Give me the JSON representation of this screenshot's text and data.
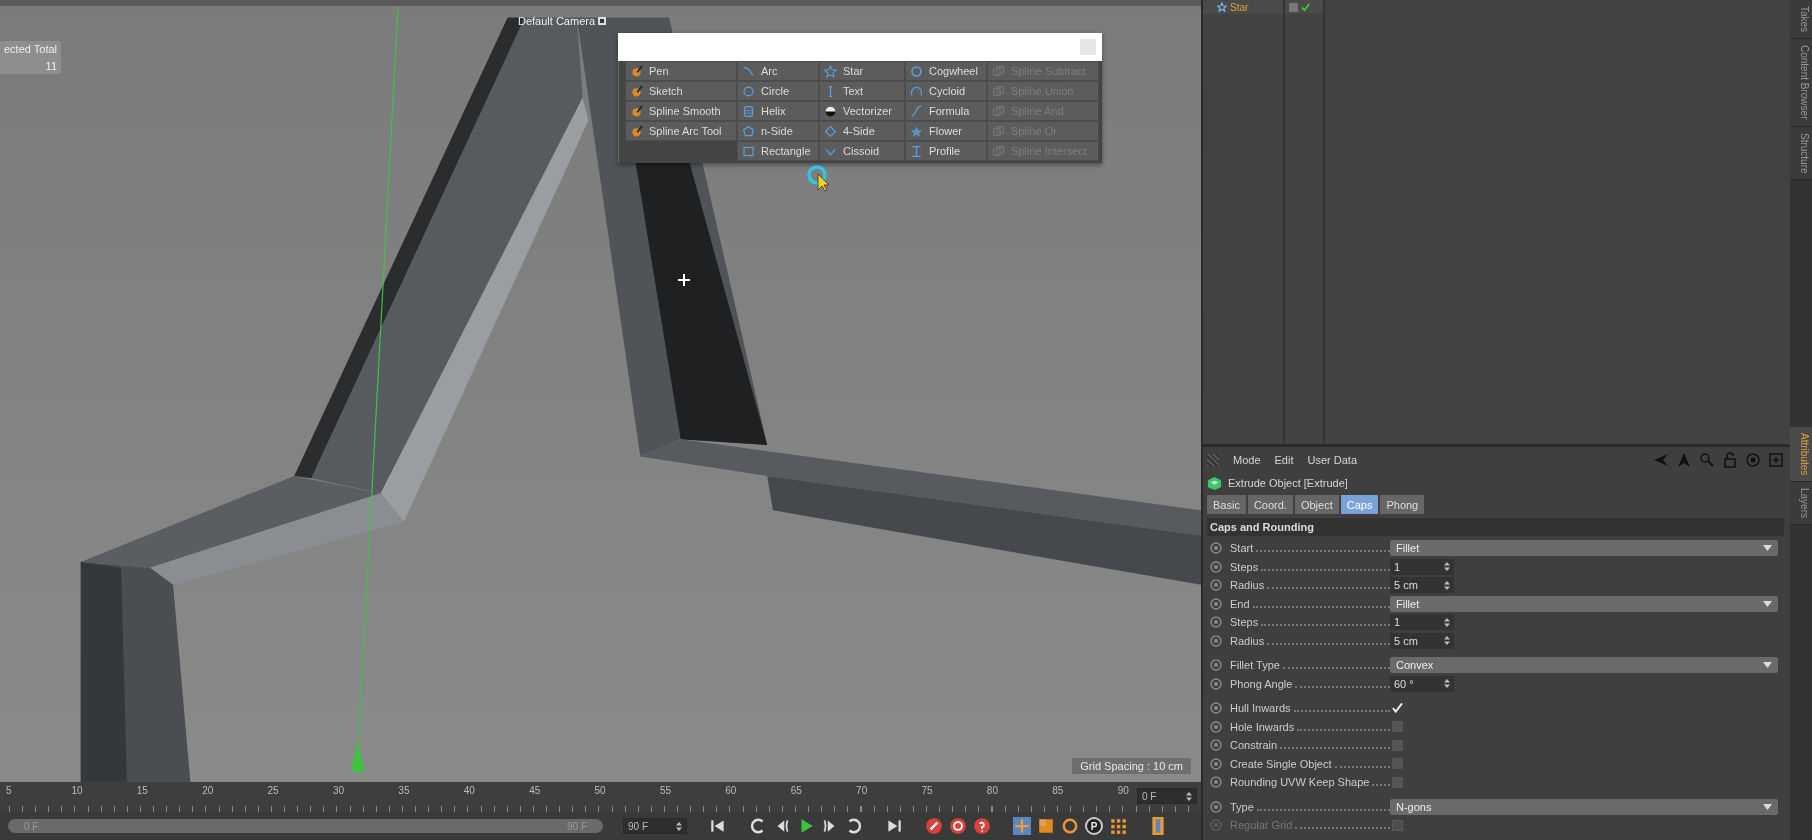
{
  "viewport": {
    "camera_label": "Default Camera",
    "hud": {
      "header": "ected Total",
      "value": "11"
    },
    "grid_spacing": "Grid Spacing : 10 cm"
  },
  "spline_menu": {
    "columns": [
      {
        "items": [
          {
            "label": "Pen",
            "disabled": false
          },
          {
            "label": "Sketch",
            "disabled": false
          },
          {
            "label": "Spline Smooth",
            "disabled": false
          },
          {
            "label": "Spline Arc Tool",
            "disabled": false
          }
        ]
      },
      {
        "items": [
          {
            "label": "Arc",
            "disabled": false
          },
          {
            "label": "Circle",
            "disabled": false
          },
          {
            "label": "Helix",
            "disabled": false
          },
          {
            "label": "n-Side",
            "disabled": false
          },
          {
            "label": "Rectangle",
            "disabled": false
          }
        ]
      },
      {
        "items": [
          {
            "label": "Star",
            "disabled": false
          },
          {
            "label": "Text",
            "disabled": false
          },
          {
            "label": "Vectorizer",
            "disabled": false
          },
          {
            "label": "4-Side",
            "disabled": false
          },
          {
            "label": "Cissoid",
            "disabled": false
          }
        ]
      },
      {
        "items": [
          {
            "label": "Cogwheel",
            "disabled": false
          },
          {
            "label": "Cycloid",
            "disabled": false
          },
          {
            "label": "Formula",
            "disabled": false
          },
          {
            "label": "Flower",
            "disabled": false
          },
          {
            "label": "Profile",
            "disabled": false
          }
        ]
      },
      {
        "items": [
          {
            "label": "Spline Subtract",
            "disabled": true
          },
          {
            "label": "Spline Union",
            "disabled": true
          },
          {
            "label": "Spline And",
            "disabled": true
          },
          {
            "label": "Spline Or",
            "disabled": true
          },
          {
            "label": "Spline Intersect",
            "disabled": true
          }
        ]
      }
    ]
  },
  "object_manager": {
    "rows": [
      {
        "name": "Star"
      }
    ]
  },
  "side_tabs_top": [
    {
      "label": "Takes"
    },
    {
      "label": "Content Browser"
    },
    {
      "label": "Structure"
    }
  ],
  "attributes": {
    "menu": [
      "Mode",
      "Edit",
      "User Data"
    ],
    "title": "Extrude Object [Extrude]",
    "tabs": [
      {
        "label": "Basic",
        "selected": false
      },
      {
        "label": "Coord.",
        "selected": false
      },
      {
        "label": "Object",
        "selected": false
      },
      {
        "label": "Caps",
        "selected": true
      },
      {
        "label": "Phong",
        "selected": false
      }
    ],
    "section": "Caps and Rounding",
    "groups": [
      {
        "params": [
          {
            "label": "Start",
            "kind": "dropdown",
            "value": "Fillet",
            "disabled": false
          },
          {
            "label": "Steps",
            "kind": "number",
            "value": "1",
            "disabled": false
          },
          {
            "label": "Radius",
            "kind": "number",
            "value": "5 cm",
            "disabled": false
          },
          {
            "label": "End",
            "kind": "dropdown",
            "value": "Fillet",
            "disabled": false
          },
          {
            "label": "Steps",
            "kind": "number",
            "value": "1",
            "disabled": false
          },
          {
            "label": "Radius",
            "kind": "number",
            "value": "5 cm",
            "disabled": false
          }
        ]
      },
      {
        "params": [
          {
            "label": "Fillet Type",
            "kind": "dropdown",
            "value": "Convex",
            "disabled": false
          },
          {
            "label": "Phong Angle",
            "kind": "number",
            "value": "60 °",
            "disabled": false
          }
        ]
      },
      {
        "params": [
          {
            "label": "Hull Inwards",
            "kind": "checkbox",
            "checked": true,
            "disabled": false
          },
          {
            "label": "Hole Inwards",
            "kind": "checkbox",
            "checked": false,
            "disabled": false
          },
          {
            "label": "Constrain",
            "kind": "checkbox",
            "checked": false,
            "disabled": false
          },
          {
            "label": "Create Single Object",
            "kind": "checkbox",
            "checked": false,
            "disabled": false
          },
          {
            "label": "Rounding UVW Keep Shape",
            "kind": "checkbox",
            "checked": false,
            "disabled": false
          }
        ]
      },
      {
        "params": [
          {
            "label": "Type",
            "kind": "dropdown",
            "value": "N-gons",
            "disabled": false
          },
          {
            "label": "Regular Grid",
            "kind": "checkbox",
            "checked": false,
            "disabled": true
          }
        ]
      }
    ]
  },
  "side_tabs_bottom": [
    {
      "label": "Attributes",
      "selected": true
    },
    {
      "label": "Layers",
      "selected": false
    }
  ],
  "timeline": {
    "ticks": [
      "5",
      "10",
      "15",
      "20",
      "25",
      "30",
      "35",
      "40",
      "45",
      "50",
      "55",
      "60",
      "65",
      "70",
      "75",
      "80",
      "85",
      "90"
    ],
    "current_frame": "0 F",
    "range_start": "0 F",
    "range_end": "90 F",
    "end_frame": "90 F",
    "parameter_key_glyph": "P"
  }
}
